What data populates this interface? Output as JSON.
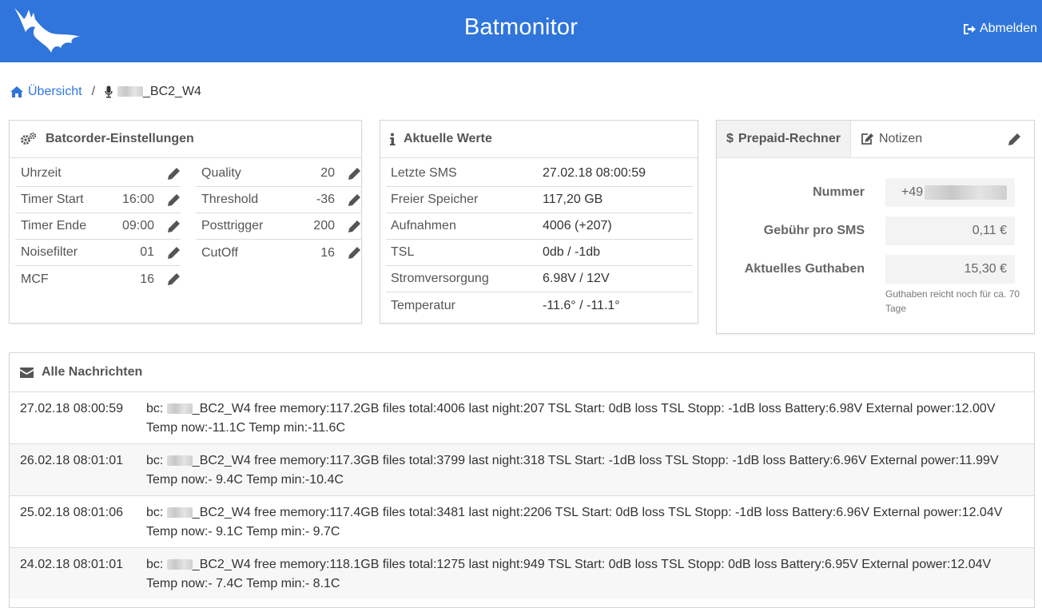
{
  "header": {
    "title": "Batmonitor",
    "logout_label": "Abmelden"
  },
  "breadcrumb": {
    "home_label": "Übersicht",
    "separator": "/",
    "current_label": "_BC2_W4"
  },
  "settings": {
    "title": "Batcorder-Einstellungen",
    "left": [
      {
        "label": "Uhrzeit",
        "value": ""
      },
      {
        "label": "Timer Start",
        "value": "16:00"
      },
      {
        "label": "Timer Ende",
        "value": "09:00"
      },
      {
        "label": "Noisefilter",
        "value": "01"
      },
      {
        "label": "MCF",
        "value": "16"
      }
    ],
    "right": [
      {
        "label": "Quality",
        "value": "20"
      },
      {
        "label": "Threshold",
        "value": "-36"
      },
      {
        "label": "Posttrigger",
        "value": "200"
      },
      {
        "label": "CutOff",
        "value": "16"
      }
    ]
  },
  "current": {
    "title": "Aktuelle Werte",
    "rows": [
      {
        "label": "Letzte SMS",
        "value": "27.02.18 08:00:59"
      },
      {
        "label": "Freier Speicher",
        "value": "117,20 GB"
      },
      {
        "label": "Aufnahmen",
        "value": "4006 (+207)"
      },
      {
        "label": "TSL",
        "value": "0db / -1db"
      },
      {
        "label": "Stromversorgung",
        "value": "6.98V / 12V"
      },
      {
        "label": "Temperatur",
        "value": "-11.6° / -11.1°"
      }
    ]
  },
  "prepaid": {
    "tab_prepaid": "Prepaid-Rechner",
    "tab_prepaid_symbol": "$",
    "tab_notes": "Notizen",
    "number_label": "Nummer",
    "number_value": "+49",
    "fee_label": "Gebühr pro SMS",
    "fee_value": "0,11 €",
    "balance_label": "Aktuelles Guthaben",
    "balance_value": "15,30 €",
    "hint": "Guthaben reicht noch für ca. 70 Tage"
  },
  "messages": {
    "title": "Alle Nachrichten",
    "items": [
      {
        "date": "27.02.18 08:00:59",
        "prefix": "bc: ",
        "text": "_BC2_W4 free memory:117.2GB files total:4006 last night:207 TSL Start: 0dB loss TSL Stopp: -1dB loss Battery:6.98V External power:12.00V Temp now:-11.1C Temp min:-11.6C"
      },
      {
        "date": "26.02.18 08:01:01",
        "prefix": "bc: ",
        "text": "_BC2_W4 free memory:117.3GB files total:3799 last night:318 TSL Start: -1dB loss TSL Stopp: -1dB loss Battery:6.96V External power:11.99V Temp now:- 9.4C Temp min:-10.4C"
      },
      {
        "date": "25.02.18 08:01:06",
        "prefix": "bc: ",
        "text": "_BC2_W4 free memory:117.4GB files total:3481 last night:2206 TSL Start: 0dB loss TSL Stopp: -1dB loss Battery:6.96V External power:12.04V Temp now:- 9.1C Temp min:- 9.7C"
      },
      {
        "date": "24.02.18 08:01:01",
        "prefix": "bc: ",
        "text": "_BC2_W4 free memory:118.1GB files total:1275 last night:949 TSL Start: 0dB loss TSL Stopp: 0dB loss Battery:6.95V External power:12.04V Temp now:- 7.4C Temp min:- 8.1C"
      }
    ]
  },
  "colors": {
    "brand": "#2f75dc",
    "text": "#333333",
    "muted": "#555555"
  }
}
